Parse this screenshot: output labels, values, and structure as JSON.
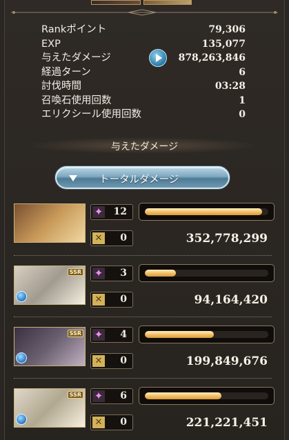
{
  "stats": [
    {
      "label": "Rankポイント",
      "value": "79,306"
    },
    {
      "label": "EXP",
      "value": "135,077"
    },
    {
      "label": "与えたダメージ",
      "value": "878,263,846"
    },
    {
      "label": "経過ターン",
      "value": "6"
    },
    {
      "label": "討伐時間",
      "value": "03:28"
    },
    {
      "label": "召喚石使用回数",
      "value": "1"
    },
    {
      "label": "エリクシール使用回数",
      "value": "0"
    }
  ],
  "section_title": "与えたダメージ",
  "total_damage_button": "トータルダメージ",
  "members": [
    {
      "attacks": "12",
      "breaks": "0",
      "damage": "352,778,299",
      "share": 0.95,
      "ssr": "",
      "colors": [
        "#7a5030",
        "#c89a5a",
        "#f0d8a0"
      ]
    },
    {
      "attacks": "3",
      "breaks": "0",
      "damage": "94,164,420",
      "share": 0.25,
      "ssr": "SSR",
      "colors": [
        "#d8d0c0",
        "#a09a90",
        "#f6f0e0"
      ]
    },
    {
      "attacks": "4",
      "breaks": "0",
      "damage": "199,849,676",
      "share": 0.56,
      "ssr": "SSR",
      "colors": [
        "#3a3040",
        "#6a6070",
        "#c0b0c0"
      ]
    },
    {
      "attacks": "6",
      "breaks": "0",
      "damage": "221,221,451",
      "share": 0.62,
      "ssr": "SSR",
      "colors": [
        "#e0d8c8",
        "#b0a890",
        "#f8f0e0"
      ]
    }
  ],
  "icons": {
    "damage_play": "play-icon",
    "dropdown": "triangle-down-icon",
    "attack_count": "sparkle-icon",
    "break_count": "cross-icon",
    "element": "water-element-icon"
  },
  "colors": {
    "bar_fill": "#f4c16a",
    "button": "#7ea7bf"
  }
}
